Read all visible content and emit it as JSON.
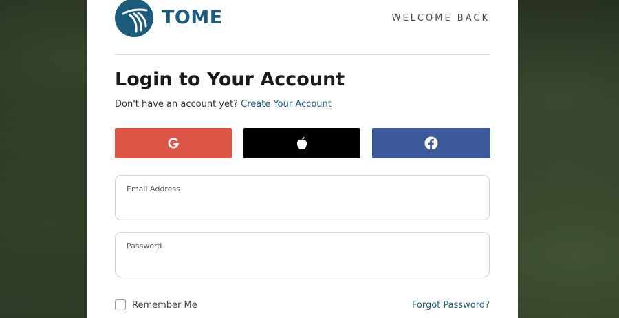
{
  "brand": {
    "name": "TOME",
    "color": "#1c5b7a"
  },
  "header": {
    "welcome": "WELCOME BACK"
  },
  "login": {
    "title": "Login to Your Account",
    "prompt": "Don't have an account yet?",
    "create_link": "Create Your Account"
  },
  "social": [
    {
      "name": "google",
      "icon": "google-g-icon",
      "color": "#dd5546"
    },
    {
      "name": "apple",
      "icon": "apple-icon",
      "color": "#000000"
    },
    {
      "name": "facebook",
      "icon": "facebook-icon",
      "color": "#3c5a99"
    }
  ],
  "fields": {
    "email": {
      "label": "Email Address",
      "value": ""
    },
    "password": {
      "label": "Password",
      "value": ""
    }
  },
  "options": {
    "remember_label": "Remember Me",
    "remember_checked": false,
    "forgot_link": "Forgot Password?"
  }
}
